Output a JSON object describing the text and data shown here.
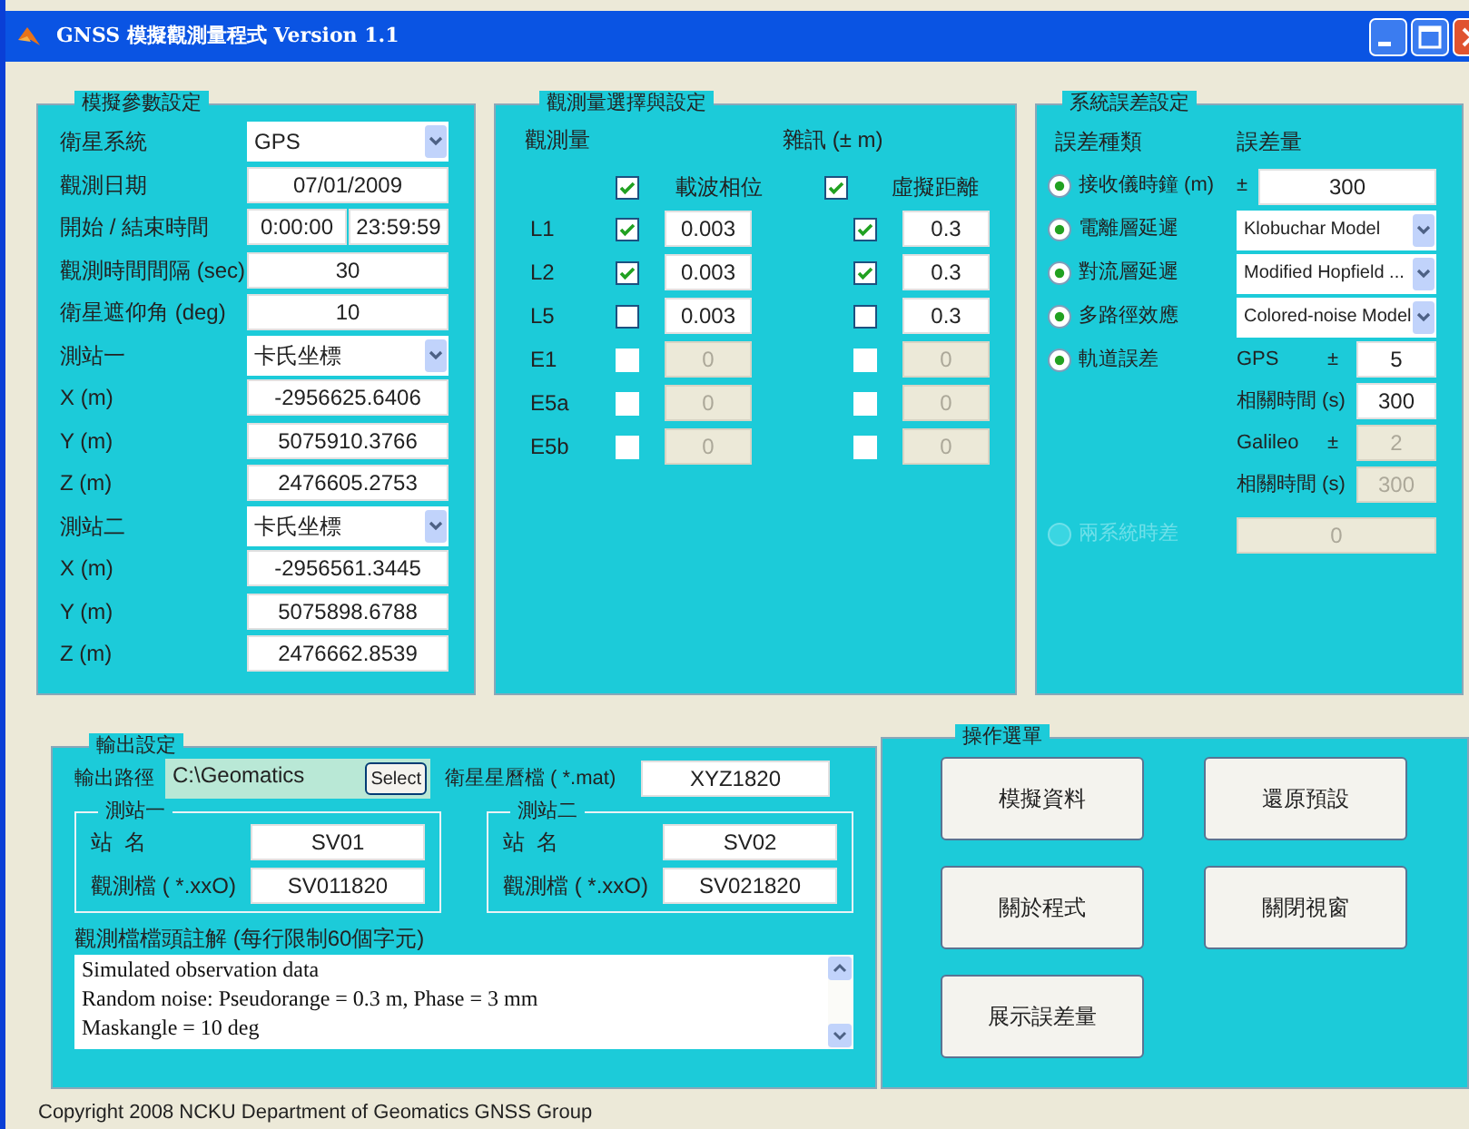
{
  "window": {
    "title": "GNSS 模擬觀測量程式 Version 1.1"
  },
  "sim_params": {
    "title": "模擬參數設定",
    "rows": [
      {
        "kind": "select",
        "label": "衛星系統",
        "value": "GPS"
      },
      {
        "kind": "text",
        "label": "觀測日期",
        "value": "07/01/2009"
      },
      {
        "kind": "pair",
        "label": "開始 / 結束時間",
        "values": [
          "0:00:00",
          "23:59:59"
        ]
      },
      {
        "kind": "text",
        "label": "觀測時間間隔 (sec)",
        "value": "30"
      },
      {
        "kind": "text",
        "label": "衛星遮仰角 (deg)",
        "value": "10"
      },
      {
        "kind": "select",
        "label": "測站一",
        "value": "卡氏坐標"
      },
      {
        "kind": "text",
        "label": "X (m)",
        "value": "-2956625.6406"
      },
      {
        "kind": "text",
        "label": "Y (m)",
        "value": "5075910.3766"
      },
      {
        "kind": "text",
        "label": "Z (m)",
        "value": "2476605.2753"
      },
      {
        "kind": "select",
        "label": "測站二",
        "value": "卡氏坐標"
      },
      {
        "kind": "text",
        "label": "X (m)",
        "value": "-2956561.3445"
      },
      {
        "kind": "text",
        "label": "Y (m)",
        "value": "5075898.6788"
      },
      {
        "kind": "text",
        "label": "Z (m)",
        "value": "2476662.8539"
      }
    ]
  },
  "observables": {
    "title": "觀測量選擇與設定",
    "header_observable": "觀測量",
    "header_noise": "雜訊 (± m)",
    "phase_header": {
      "checked": true,
      "label": "載波相位"
    },
    "range_header": {
      "checked": true,
      "label": "虛擬距離"
    },
    "rows": [
      {
        "label": "L1",
        "phase": {
          "checked": true,
          "disabled": false,
          "value": "0.003"
        },
        "range": {
          "checked": true,
          "disabled": false,
          "value": "0.3"
        }
      },
      {
        "label": "L2",
        "phase": {
          "checked": true,
          "disabled": false,
          "value": "0.003"
        },
        "range": {
          "checked": true,
          "disabled": false,
          "value": "0.3"
        }
      },
      {
        "label": "L5",
        "phase": {
          "checked": false,
          "disabled": false,
          "value": "0.003"
        },
        "range": {
          "checked": false,
          "disabled": false,
          "value": "0.3"
        }
      },
      {
        "label": "E1",
        "phase": {
          "checked": false,
          "disabled": true,
          "value": "0"
        },
        "range": {
          "checked": false,
          "disabled": true,
          "value": "0"
        }
      },
      {
        "label": "E5a",
        "phase": {
          "checked": false,
          "disabled": true,
          "value": "0"
        },
        "range": {
          "checked": false,
          "disabled": true,
          "value": "0"
        }
      },
      {
        "label": "E5b",
        "phase": {
          "checked": false,
          "disabled": true,
          "value": "0"
        },
        "range": {
          "checked": false,
          "disabled": true,
          "value": "0"
        }
      }
    ]
  },
  "errors": {
    "title": "系統誤差設定",
    "header_type": "誤差種類",
    "header_amount": "誤差量",
    "rows": [
      {
        "kind": "field",
        "on": true,
        "disabled": false,
        "label": "接收儀時鐘 (m)",
        "sign": "±",
        "value": "300"
      },
      {
        "kind": "select",
        "on": true,
        "disabled": false,
        "label": "電離層延遲",
        "value": "Klobuchar Model"
      },
      {
        "kind": "select",
        "on": true,
        "disabled": false,
        "label": "對流層延遲",
        "value": "Modified Hopfield ..."
      },
      {
        "kind": "select",
        "on": true,
        "disabled": false,
        "label": "多路徑效應",
        "value": "Colored-noise Model"
      },
      {
        "kind": "orbit",
        "on": true,
        "disabled": false,
        "label": "軌道誤差",
        "subrows": [
          {
            "label": "GPS",
            "sign": "±",
            "value": "5",
            "disabled": false
          },
          {
            "label": "相關時間 (s)",
            "value": "300",
            "disabled": false
          },
          {
            "label": "Galileo",
            "sign": "±",
            "value": "2",
            "disabled": true
          },
          {
            "label": "相關時間 (s)",
            "value": "300",
            "disabled": true
          }
        ]
      },
      {
        "kind": "field",
        "on": false,
        "disabled": true,
        "label": "兩系統時差",
        "value": "0"
      }
    ]
  },
  "output": {
    "title": "輸出設定",
    "path_label": "輸出路徑",
    "path_value": "C:\\Geomatics",
    "select_button": "Select",
    "ephemeris_label": "衛星星曆檔 ( *.mat)",
    "ephemeris_value": "XYZ1820",
    "stations": [
      {
        "title": "測站一",
        "name_label": "站  名",
        "name_value": "SV01",
        "obs_label": "觀測檔 ( *.xxO)",
        "obs_value": "SV011820"
      },
      {
        "title": "測站二",
        "name_label": "站  名",
        "name_value": "SV02",
        "obs_label": "觀測檔 ( *.xxO)",
        "obs_value": "SV021820"
      }
    ],
    "comment_label": "觀測檔檔頭註解 (每行限制60個字元)",
    "comment_lines": [
      "Simulated observation data",
      "Random noise: Pseudorange = 0.3 m, Phase = 3 mm",
      "Maskangle = 10 deg"
    ]
  },
  "operations": {
    "title": "操作選單",
    "buttons": [
      "模擬資料",
      "還原預設",
      "關於程式",
      "關閉視窗",
      "展示誤差量"
    ]
  },
  "status_bar": "Copyright 2008 NCKU Department of Geomatics GNSS Group"
}
